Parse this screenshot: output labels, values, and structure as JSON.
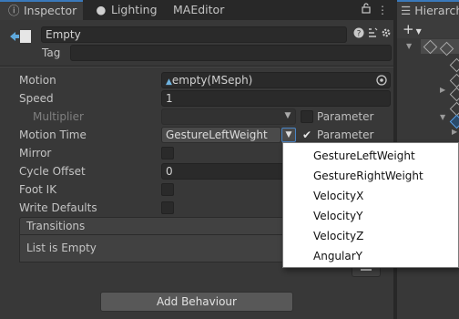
{
  "tabs": [
    {
      "label": "Inspector",
      "icon": "info-icon"
    },
    {
      "label": "Lighting",
      "icon": "lightbulb-icon"
    },
    {
      "label": "MAEditor"
    }
  ],
  "hierarchy": {
    "tab_label": "Hierarchy",
    "add_symbol": "+"
  },
  "object": {
    "name": "Empty",
    "tag_label": "Tag",
    "tag_value": ""
  },
  "properties": {
    "motion": {
      "label": "Motion",
      "value": "empty(MSeph)"
    },
    "speed": {
      "label": "Speed",
      "value": "1"
    },
    "multiplier": {
      "label": "Multiplier",
      "param_label": "Parameter",
      "param_checked": false
    },
    "motion_time": {
      "label": "Motion Time",
      "value": "GestureLeftWeight",
      "param_label": "Parameter",
      "param_checked": true
    },
    "mirror": {
      "label": "Mirror",
      "checked": false
    },
    "cycle_offset": {
      "label": "Cycle Offset",
      "value": "0"
    },
    "foot_ik": {
      "label": "Foot IK",
      "checked": false
    },
    "write_defaults": {
      "label": "Write Defaults",
      "checked": false
    }
  },
  "transitions": {
    "header": "Transitions",
    "empty_text": "List is Empty"
  },
  "add_behaviour_label": "Add Behaviour",
  "dropdown_options": [
    "GestureLeftWeight",
    "GestureRightWeight",
    "VelocityX",
    "VelocityY",
    "VelocityZ",
    "AngularY"
  ],
  "colors": {
    "accent": "#3a79bb",
    "background": "#383838",
    "field": "#2a2a2a",
    "dropdown": "#ffffff"
  }
}
